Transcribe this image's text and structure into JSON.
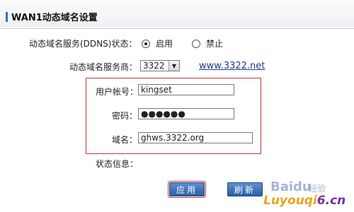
{
  "header": {
    "title": "WAN1动态域名设置"
  },
  "ddns_status": {
    "label": "动态域名服务(DDNS)状态：",
    "options": [
      {
        "label": "启用",
        "selected": true
      },
      {
        "label": "禁止",
        "selected": false
      }
    ]
  },
  "provider": {
    "label": "动态域名服务商：",
    "selected": "3322",
    "link": "www.3322.net"
  },
  "account": {
    "username_label": "用户帐号：",
    "username_value": "kingset",
    "password_label": "密码：",
    "password_value": "●●●●●●",
    "domain_label": "域名：",
    "domain_value": "ghws.3322.org"
  },
  "status_info": {
    "label": "状态信息："
  },
  "buttons": {
    "apply": "应用",
    "refresh": "刷新"
  },
  "watermark": {
    "brand": "Baidu",
    "sub": "经验",
    "site_a": "Luyouqi",
    "site_b": "6.cn"
  },
  "colors": {
    "accent": "#2c5ea6",
    "highlight": "#c9343a",
    "link": "#1b3a8a"
  }
}
